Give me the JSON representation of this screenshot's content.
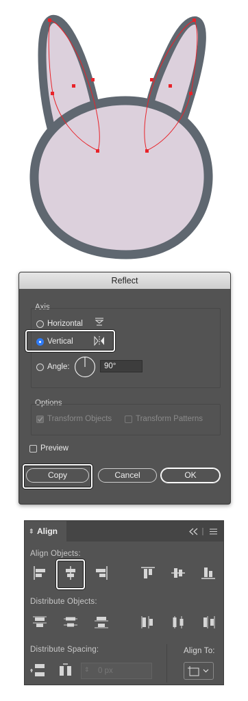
{
  "reflect_dialog": {
    "title": "Reflect",
    "axis_label": "Axis",
    "horizontal_label": "Horizontal",
    "vertical_label": "Vertical",
    "angle_label": "Angle:",
    "angle_value": "90°",
    "options_label": "Options",
    "transform_objects_label": "Transform Objects",
    "transform_patterns_label": "Transform Patterns",
    "preview_label": "Preview",
    "copy_label": "Copy",
    "cancel_label": "Cancel",
    "ok_label": "OK",
    "selected_axis": "Vertical"
  },
  "align_panel": {
    "tab_label": "Align",
    "align_objects_label": "Align Objects:",
    "distribute_objects_label": "Distribute Objects:",
    "distribute_spacing_label": "Distribute Spacing:",
    "align_to_label": "Align To:",
    "spacing_value": "0 px",
    "highlighted_button": "horizontal-align-center"
  },
  "colors": {
    "bunny_fill": "#dcd0dc",
    "bunny_stroke": "#5f6770",
    "path_red": "#e8232a",
    "dialog_bg": "#535353",
    "accent_blue": "#2f7bf6"
  }
}
